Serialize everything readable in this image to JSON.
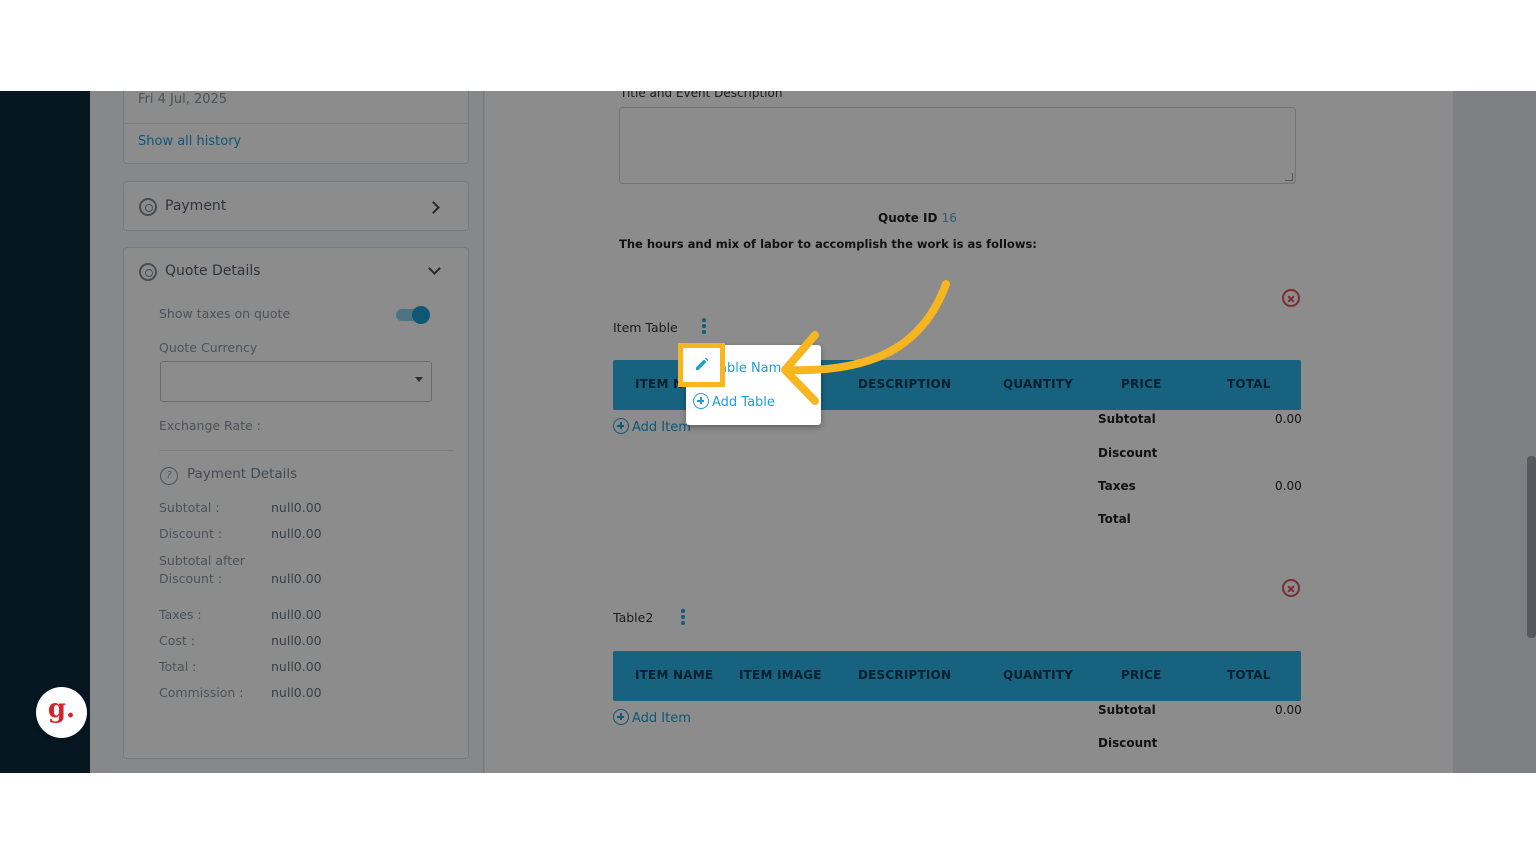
{
  "history": {
    "date": "Fri 4 Jul, 2025",
    "show_all_label": "Show all history"
  },
  "payment_card": {
    "title": "Payment"
  },
  "quote_details": {
    "title": "Quote Details",
    "show_taxes_label": "Show taxes on quote",
    "show_taxes_on": true,
    "currency_label": "Quote Currency",
    "currency_value": "",
    "exchange_rate_label": "Exchange Rate :",
    "payment_details_title": "Payment Details",
    "rows": [
      {
        "label": "Subtotal :",
        "value": "null0.00"
      },
      {
        "label": "Discount :",
        "value": "null0.00"
      },
      {
        "label": "Subtotal after",
        "label2": "Discount :",
        "value": "null0.00"
      },
      {
        "label": "Taxes :",
        "value": "null0.00"
      },
      {
        "label": "Cost :",
        "value": "null0.00"
      },
      {
        "label": "Total :",
        "value": "null0.00"
      },
      {
        "label": "Commission :",
        "value": "null0.00"
      }
    ]
  },
  "main": {
    "title_desc_label": "Title and Event Description",
    "quote_id_label": "Quote ID",
    "quote_id_value": "16",
    "hours_text": "The hours and mix of labor to accomplish the work is as follows:",
    "table1": {
      "name": "Item Table",
      "col_item_name_partial": "ITEM N",
      "col_description": "DESCRIPTION",
      "col_quantity": "QUANTITY",
      "col_price": "PRICE",
      "col_total": "TOTAL",
      "add_item": "Add Item",
      "subtotal_label": "Subtotal",
      "subtotal_value": "0.00",
      "discount_label": "Discount",
      "taxes_label": "Taxes",
      "taxes_value": "0.00",
      "total_label": "Total"
    },
    "table2": {
      "name": "Table2",
      "col_item_name": "ITEM NAME",
      "col_item_image": "ITEM IMAGE",
      "col_description": "DESCRIPTION",
      "col_quantity": "QUANTITY",
      "col_price": "PRICE",
      "col_total": "TOTAL",
      "add_item": "Add Item",
      "subtotal_label": "Subtotal",
      "subtotal_value": "0.00",
      "discount_label": "Discount"
    }
  },
  "popup": {
    "edit_label_partial": "able Nam",
    "add_table_label": "Add Table"
  },
  "logo": {
    "letter": "g."
  },
  "colors": {
    "accent": "#2bb3e6",
    "highlight": "#f7b520",
    "danger": "#e0525a",
    "rail": "#0b2a3f"
  },
  "icons": [
    "gear-icon",
    "chevron-right-icon",
    "chevron-down-icon",
    "toggle-switch",
    "dropdown-caret-icon",
    "info-icon",
    "plus-circle-icon",
    "close-circle-icon",
    "kebab-menu-icon",
    "pencil-icon",
    "arrow-annotation"
  ]
}
